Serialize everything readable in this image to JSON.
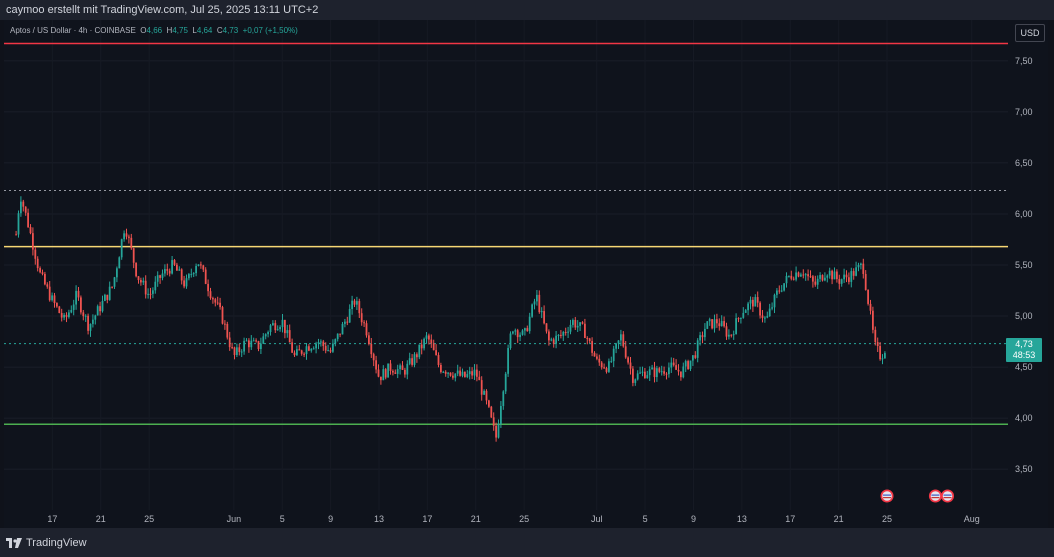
{
  "header": {
    "caption": "caymoo erstellt mit TradingView.com, Jul 25, 2025 13:11 UTC+2"
  },
  "legend": {
    "symbol": "Aptos / US Dollar · 4h · COINBASE",
    "o_label": "O",
    "o_value": "4,66",
    "h_label": "H",
    "h_value": "4,75",
    "l_label": "L",
    "l_value": "4,64",
    "c_label": "C",
    "c_value": "4,73",
    "change": "+0,07 (+1,50%)"
  },
  "currency_button": "USD",
  "price_tag": {
    "price": "4,73",
    "countdown": "48:53"
  },
  "footer": {
    "brand": "TradingView"
  },
  "colors": {
    "up": "#26a69a",
    "down": "#ef5350",
    "resistance_top": "#f23645",
    "resistance": "#f7d774",
    "support": "#4caf50",
    "background": "#0f131c"
  },
  "chart_data": {
    "type": "candlestick",
    "title": "Aptos / US Dollar · 4h · COINBASE",
    "ylim": [
      3.1,
      7.9
    ],
    "y_ticks": [
      {
        "v": 7.5,
        "label": "7,50"
      },
      {
        "v": 7.0,
        "label": "7,00"
      },
      {
        "v": 6.5,
        "label": "6,50"
      },
      {
        "v": 6.0,
        "label": "6,00"
      },
      {
        "v": 5.5,
        "label": "5,50"
      },
      {
        "v": 5.0,
        "label": "5,00"
      },
      {
        "v": 4.5,
        "label": "4,50"
      },
      {
        "v": 4.0,
        "label": "4,00"
      },
      {
        "v": 3.5,
        "label": "3,50"
      }
    ],
    "x_ticks": [
      {
        "date": "2025-05-17",
        "label": "17"
      },
      {
        "date": "2025-05-21",
        "label": "21"
      },
      {
        "date": "2025-05-25",
        "label": "25"
      },
      {
        "date": "2025-06-01",
        "label": "Jun"
      },
      {
        "date": "2025-06-05",
        "label": "5"
      },
      {
        "date": "2025-06-09",
        "label": "9"
      },
      {
        "date": "2025-06-13",
        "label": "13"
      },
      {
        "date": "2025-06-17",
        "label": "17"
      },
      {
        "date": "2025-06-21",
        "label": "21"
      },
      {
        "date": "2025-06-25",
        "label": "25"
      },
      {
        "date": "2025-07-01",
        "label": "Jul"
      },
      {
        "date": "2025-07-05",
        "label": "5"
      },
      {
        "date": "2025-07-09",
        "label": "9"
      },
      {
        "date": "2025-07-13",
        "label": "13"
      },
      {
        "date": "2025-07-17",
        "label": "17"
      },
      {
        "date": "2025-07-21",
        "label": "21"
      },
      {
        "date": "2025-07-25",
        "label": "25"
      },
      {
        "date": "2025-08-01",
        "label": "Aug"
      }
    ],
    "horizontal_lines": [
      {
        "y": 7.67,
        "style": "solid",
        "color": "#f23645"
      },
      {
        "y": 6.23,
        "style": "dotted",
        "color": "#9598a1"
      },
      {
        "y": 5.68,
        "style": "solid",
        "color": "#f7d774"
      },
      {
        "y": 3.94,
        "style": "solid",
        "color": "#4caf50"
      },
      {
        "y": 4.73,
        "style": "dotted",
        "color": "#26a69a"
      }
    ],
    "close_path": [
      {
        "date": "2025-05-14",
        "close": 5.8
      },
      {
        "date": "2025-05-14T08:00",
        "close": 6.2
      },
      {
        "date": "2025-05-15",
        "close": 5.9
      },
      {
        "date": "2025-05-16",
        "close": 5.4
      },
      {
        "date": "2025-05-17",
        "close": 5.15
      },
      {
        "date": "2025-05-18",
        "close": 4.95
      },
      {
        "date": "2025-05-19",
        "close": 5.2
      },
      {
        "date": "2025-05-20",
        "close": 4.9
      },
      {
        "date": "2025-05-21",
        "close": 5.1
      },
      {
        "date": "2025-05-22",
        "close": 5.3
      },
      {
        "date": "2025-05-23",
        "close": 5.9
      },
      {
        "date": "2025-05-24",
        "close": 5.4
      },
      {
        "date": "2025-05-25",
        "close": 5.2
      },
      {
        "date": "2025-05-26",
        "close": 5.4
      },
      {
        "date": "2025-05-27",
        "close": 5.5
      },
      {
        "date": "2025-05-28",
        "close": 5.3
      },
      {
        "date": "2025-05-29",
        "close": 5.55
      },
      {
        "date": "2025-05-30",
        "close": 5.25
      },
      {
        "date": "2025-05-31",
        "close": 5.0
      },
      {
        "date": "2025-06-01",
        "close": 4.6
      },
      {
        "date": "2025-06-02",
        "close": 4.75
      },
      {
        "date": "2025-06-03",
        "close": 4.7
      },
      {
        "date": "2025-06-04",
        "close": 4.9
      },
      {
        "date": "2025-06-05",
        "close": 4.95
      },
      {
        "date": "2025-06-06",
        "close": 4.6
      },
      {
        "date": "2025-06-07",
        "close": 4.7
      },
      {
        "date": "2025-06-08",
        "close": 4.75
      },
      {
        "date": "2025-06-09",
        "close": 4.65
      },
      {
        "date": "2025-06-10",
        "close": 4.9
      },
      {
        "date": "2025-06-11",
        "close": 5.15
      },
      {
        "date": "2025-06-12",
        "close": 4.85
      },
      {
        "date": "2025-06-13",
        "close": 4.4
      },
      {
        "date": "2025-06-14",
        "close": 4.5
      },
      {
        "date": "2025-06-15",
        "close": 4.45
      },
      {
        "date": "2025-06-16",
        "close": 4.6
      },
      {
        "date": "2025-06-17",
        "close": 4.8
      },
      {
        "date": "2025-06-18",
        "close": 4.5
      },
      {
        "date": "2025-06-19",
        "close": 4.45
      },
      {
        "date": "2025-06-20",
        "close": 4.4
      },
      {
        "date": "2025-06-21",
        "close": 4.45
      },
      {
        "date": "2025-06-22",
        "close": 4.1
      },
      {
        "date": "2025-06-22T16:00",
        "close": 3.8
      },
      {
        "date": "2025-06-23",
        "close": 4.1
      },
      {
        "date": "2025-06-24",
        "close": 4.9
      },
      {
        "date": "2025-06-25",
        "close": 4.8
      },
      {
        "date": "2025-06-26",
        "close": 5.2
      },
      {
        "date": "2025-06-27",
        "close": 4.75
      },
      {
        "date": "2025-06-28",
        "close": 4.8
      },
      {
        "date": "2025-06-29",
        "close": 4.95
      },
      {
        "date": "2025-06-30",
        "close": 4.85
      },
      {
        "date": "2025-07-01",
        "close": 4.55
      },
      {
        "date": "2025-07-02",
        "close": 4.5
      },
      {
        "date": "2025-07-03",
        "close": 4.8
      },
      {
        "date": "2025-07-04",
        "close": 4.4
      },
      {
        "date": "2025-07-05",
        "close": 4.45
      },
      {
        "date": "2025-07-06",
        "close": 4.45
      },
      {
        "date": "2025-07-07",
        "close": 4.5
      },
      {
        "date": "2025-07-08",
        "close": 4.45
      },
      {
        "date": "2025-07-09",
        "close": 4.6
      },
      {
        "date": "2025-07-10",
        "close": 4.9
      },
      {
        "date": "2025-07-11",
        "close": 4.95
      },
      {
        "date": "2025-07-12",
        "close": 4.8
      },
      {
        "date": "2025-07-13",
        "close": 5.05
      },
      {
        "date": "2025-07-14",
        "close": 5.15
      },
      {
        "date": "2025-07-15",
        "close": 4.95
      },
      {
        "date": "2025-07-16",
        "close": 5.25
      },
      {
        "date": "2025-07-17",
        "close": 5.4
      },
      {
        "date": "2025-07-18",
        "close": 5.45
      },
      {
        "date": "2025-07-19",
        "close": 5.3
      },
      {
        "date": "2025-07-20",
        "close": 5.45
      },
      {
        "date": "2025-07-21",
        "close": 5.35
      },
      {
        "date": "2025-07-22",
        "close": 5.4
      },
      {
        "date": "2025-07-23",
        "close": 5.5
      },
      {
        "date": "2025-07-23T12:00",
        "close": 5.1
      },
      {
        "date": "2025-07-24",
        "close": 4.7
      },
      {
        "date": "2025-07-24T12:00",
        "close": 4.6
      },
      {
        "date": "2025-07-25",
        "close": 4.73
      }
    ],
    "event_markers": [
      {
        "date": "2025-07-25",
        "icon": "us-flag-icon"
      },
      {
        "date": "2025-07-29",
        "icon": "us-flag-icon"
      },
      {
        "date": "2025-07-30",
        "icon": "us-flag-icon"
      }
    ]
  }
}
